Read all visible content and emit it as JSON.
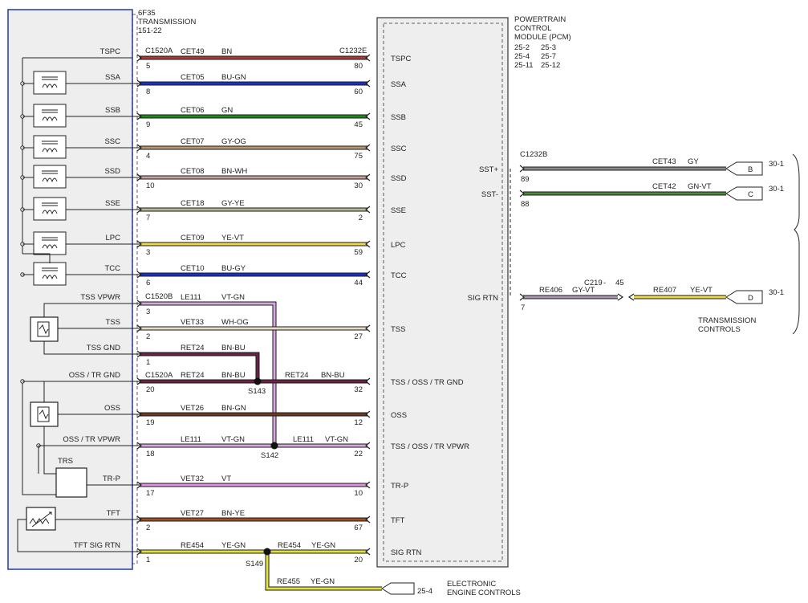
{
  "colors": {
    "BN": "#a83a3a",
    "BU-GN": "#1c2fc8",
    "GN": "#1e8a1e",
    "GY-OG": "#b89a70",
    "BN-WH": "#c9a0a0",
    "GY-YE": "#b8b890",
    "YE-VT": "#eed84a",
    "BU-GY": "#1c2fc8",
    "VT-GN": "#d8a8e0",
    "WH-OG": "#e9dcc4",
    "BN-BU": "#6a2248",
    "BN-GN": "#6a3a22",
    "VT": "#e090e0",
    "BN-YE": "#a0501e",
    "YE-GN": "#e2e23c",
    "GY": "#8a8a8a",
    "GN-VT": "#4c8a3c",
    "GY-VT": "#a898b0",
    "module_fill": "#eeeeee",
    "transmission_border": "#3344aa"
  },
  "transmission": {
    "lines": [
      "6F35",
      "TRANSMISSION",
      "151-22"
    ],
    "components": [
      {
        "label": "TSPC",
        "kind": "none"
      },
      {
        "label": "SSA",
        "kind": "solenoid"
      },
      {
        "label": "SSB",
        "kind": "solenoid"
      },
      {
        "label": "SSC",
        "kind": "solenoid"
      },
      {
        "label": "SSD",
        "kind": "solenoid"
      },
      {
        "label": "SSE",
        "kind": "solenoid"
      },
      {
        "label": "LPC",
        "kind": "solenoid"
      },
      {
        "label": "TCC",
        "kind": "solenoid"
      },
      {
        "label": "TSS",
        "kind": "sensor"
      },
      {
        "label": "OSS",
        "kind": "sensor"
      },
      {
        "label": "TRS",
        "kind": "switch"
      },
      {
        "label": "TFT",
        "kind": "thermistor"
      }
    ]
  },
  "pcm": {
    "lines": [
      "POWERTRAIN",
      "CONTROL",
      "MODULE (PCM)"
    ],
    "pages": [
      [
        "25-2",
        "25-3"
      ],
      [
        "25-4",
        "25-7"
      ],
      [
        "25-11",
        "25-12"
      ]
    ]
  },
  "connectors": {
    "c1520a_top": "C1520A",
    "c1232e": "C1232E",
    "c1520b": "C1520B",
    "c1520a_mid": "C1520A",
    "c1232b": "C1232B",
    "c219": "C219",
    "c219_pin": "45"
  },
  "circuits": [
    {
      "left_label": "TSPC",
      "circuit": "CET49",
      "color": "BN",
      "trans_pin": "5",
      "pcm_pin": "80",
      "pcm_label": "TSPC"
    },
    {
      "left_label": "SSA",
      "circuit": "CET05",
      "color": "BU-GN",
      "trans_pin": "8",
      "pcm_pin": "60",
      "pcm_label": "SSA"
    },
    {
      "left_label": "SSB",
      "circuit": "CET06",
      "color": "GN",
      "trans_pin": "9",
      "pcm_pin": "45",
      "pcm_label": "SSB"
    },
    {
      "left_label": "SSC",
      "circuit": "CET07",
      "color": "GY-OG",
      "trans_pin": "4",
      "pcm_pin": "75",
      "pcm_label": "SSC"
    },
    {
      "left_label": "SSD",
      "circuit": "CET08",
      "color": "BN-WH",
      "trans_pin": "10",
      "pcm_pin": "30",
      "pcm_label": "SSD"
    },
    {
      "left_label": "SSE",
      "circuit": "CET18",
      "color": "GY-YE",
      "trans_pin": "7",
      "pcm_pin": "2",
      "pcm_label": "SSE"
    },
    {
      "left_label": "LPC",
      "circuit": "CET09",
      "color": "YE-VT",
      "trans_pin": "3",
      "pcm_pin": "59",
      "pcm_label": "LPC"
    },
    {
      "left_label": "TCC",
      "circuit": "CET10",
      "color": "BU-GY",
      "trans_pin": "6",
      "pcm_pin": "44",
      "pcm_label": "TCC"
    },
    {
      "left_label": "TSS VPWR",
      "circuit": "LE111",
      "color": "VT-GN",
      "trans_pin": "3",
      "pcm_pin": "",
      "pcm_label": ""
    },
    {
      "left_label": "TSS",
      "circuit": "VET33",
      "color": "WH-OG",
      "trans_pin": "2",
      "pcm_pin": "27",
      "pcm_label": "TSS"
    },
    {
      "left_label": "TSS GND",
      "circuit": "RET24",
      "color": "BN-BU",
      "trans_pin": "1",
      "pcm_pin": "",
      "pcm_label": ""
    },
    {
      "left_label": "OSS / TR GND",
      "circuit": "RET24",
      "color": "BN-BU",
      "trans_pin": "20",
      "pcm_pin": "32",
      "pcm_label": "TSS / OSS / TR GND",
      "right_circuit": "RET24",
      "right_color": "BN-BU",
      "splice": "S143"
    },
    {
      "left_label": "OSS",
      "circuit": "VET26",
      "color": "BN-GN",
      "trans_pin": "19",
      "pcm_pin": "12",
      "pcm_label": "OSS"
    },
    {
      "left_label": "OSS / TR VPWR",
      "circuit": "LE111",
      "color": "VT-GN",
      "trans_pin": "18",
      "pcm_pin": "22",
      "pcm_label": "TSS / OSS / TR VPWR",
      "right_circuit": "LE111",
      "right_color": "VT-GN",
      "splice": "S142"
    },
    {
      "left_label": "TR-P",
      "circuit": "VET32",
      "color": "VT",
      "trans_pin": "17",
      "pcm_pin": "10",
      "pcm_label": "TR-P"
    },
    {
      "left_label": "TFT",
      "circuit": "VET27",
      "color": "BN-YE",
      "trans_pin": "2",
      "pcm_pin": "67",
      "pcm_label": "TFT"
    },
    {
      "left_label": "TFT SIG RTN",
      "circuit": "RE454",
      "color": "YE-GN",
      "trans_pin": "1",
      "pcm_pin": "20",
      "pcm_label": "SIG RTN",
      "right_circuit": "RE454",
      "right_color": "YE-GN",
      "splice": "S149"
    }
  ],
  "branch": {
    "circuit": "RE455",
    "color": "YE-GN",
    "target": "25-4",
    "target_label": [
      "ELECTRONIC",
      "ENGINE CONTROLS"
    ]
  },
  "right_circuits": [
    {
      "pcm_label": "SST+",
      "pin": "89",
      "circuit": "CET43",
      "color": "GY",
      "conn": "B",
      "page": "30-1"
    },
    {
      "pcm_label": "SST-",
      "pin": "88",
      "circuit": "CET42",
      "color": "GN-VT",
      "conn": "C",
      "page": "30-1"
    },
    {
      "pcm_label": "SIG RTN",
      "pin": "7",
      "circuit": "RE406",
      "color": "GY-VT",
      "conn": "D",
      "page": "30-1",
      "circuit2": "RE407",
      "color2": "YE-VT"
    }
  ],
  "trans_controls": [
    "TRANSMISSION",
    "CONTROLS"
  ]
}
